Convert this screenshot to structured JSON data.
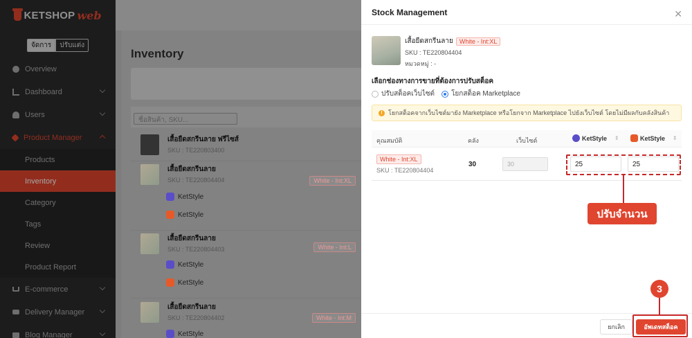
{
  "sidebar": {
    "brand": "KETSHOP",
    "brand_suffix": "web",
    "mode_active": "จัดการ",
    "mode_inactive": "ปรับแต่ง",
    "items": [
      {
        "label": "Overview",
        "icon": "pie-chart-icon"
      },
      {
        "label": "Dashboard",
        "icon": "bar-chart-icon"
      },
      {
        "label": "Users",
        "icon": "users-icon"
      },
      {
        "label": "Product Manager",
        "icon": "tag-icon"
      }
    ],
    "sub_items": [
      "Products",
      "Inventory",
      "Category",
      "Tags",
      "Review",
      "Product Report"
    ],
    "bottom_items": [
      {
        "label": "E-commerce",
        "icon": "cart-icon"
      },
      {
        "label": "Delivery Manager",
        "icon": "truck-icon"
      },
      {
        "label": "Blog Manager",
        "icon": "blog-icon"
      }
    ]
  },
  "main": {
    "title": "Inventory",
    "search_placeholder": "ชื่อสินค้า, SKU...",
    "products": [
      {
        "name": "เสื้อยืดสกรีนลาย ฟรีไซส์",
        "sku": "SKU : TE220803400",
        "badge": ""
      },
      {
        "name": "เสื้อยืดสกรีนลาย",
        "sku": "SKU : TE220804404",
        "badge": "White - Int:XL"
      },
      {
        "name": "เสื้อยืดสกรีนลาย",
        "sku": "SKU : TE220804403",
        "badge": "White - Int:L"
      },
      {
        "name": "เสื้อยืดสกรีนลาย",
        "sku": "SKU : TE220804402",
        "badge": "White - Int:M"
      }
    ],
    "channel_name": "KetStyle"
  },
  "panel": {
    "title": "Stock Management",
    "product_name": "เสื้อยืดสกรีนลาย",
    "variant": "White - Int:XL",
    "sku": "SKU : TE220804404",
    "category": "หมวดหมู่ : -",
    "section_label": "เลือกช่องทางการขายที่ต้องการปรับสต็อค",
    "radio_web": "ปรับสต็อคเว็บไซต์",
    "radio_market": "โยกสต็อค Marketplace",
    "warning": "โยกสต็อคจากเว็บไซต์มายัง Marketplace หรือโยกจาก Marketplace ไปยังเว็บไซต์ โดยไม่มีผลกับคลังสินค้า",
    "col_attr": "คุณสมบัติ",
    "col_stock": "คลัง",
    "col_web": "เว็บไซต์",
    "col_ch1": "KetStyle",
    "col_ch2": "KetStyle",
    "row": {
      "variant": "White - Int:XL",
      "sku": "SKU : TE220804404",
      "stock": "30",
      "web": "30",
      "ch1_qty": "25",
      "ch2_qty": "25"
    },
    "callout": "ปรับจำนวน",
    "step": "3",
    "cancel_label": "ยกเลิก",
    "update_label": "อัพเดทสต็อค"
  },
  "colors": {
    "accent": "#e0452f",
    "annotation": "#c62828",
    "radio": "#2f7bea"
  }
}
